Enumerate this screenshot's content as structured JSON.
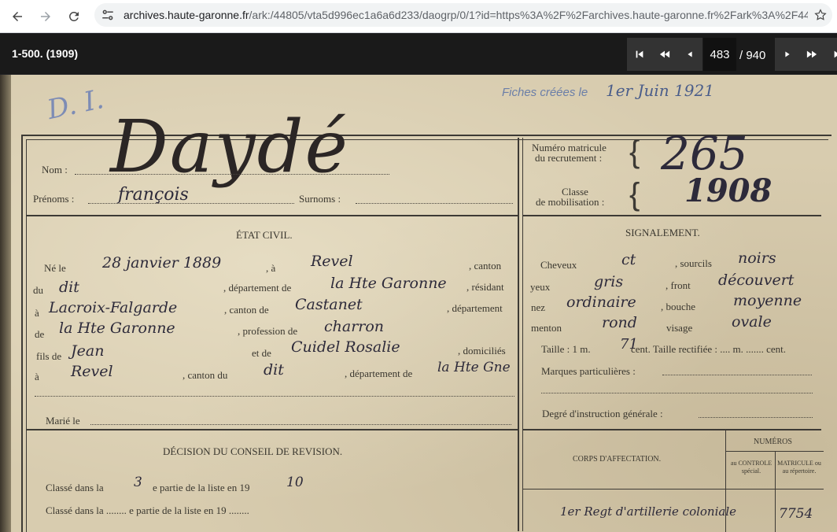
{
  "browser": {
    "url_host": "archives.haute-garonne.fr",
    "url_path": "/ark:/44805/vta5d996ec1a6a6d233/daogrp/0/1?id=https%3A%2F%2Farchives.haute-garonne.fr%2Fark%3A%2F44..."
  },
  "viewer": {
    "title": "1-500. (1909)",
    "current_page": "483",
    "total_pages": "/ 940"
  },
  "document": {
    "fiches_label": "Fiches créées le",
    "fiches_date": "1er Juin 1921",
    "stamp": "D. I.",
    "nom_label": "Nom :",
    "nom_value": "Daydé",
    "prenoms_label": "Prénoms :",
    "prenoms_value": "françois",
    "surnoms_label": "Surnoms :",
    "matricule_label_1": "Numéro matricule",
    "matricule_label_2": "du recrutement :",
    "matricule_value": "265",
    "classe_label_1": "Classe",
    "classe_label_2": "de mobilisation :",
    "classe_value": "1908",
    "etat_civil": "ÉTAT CIVIL.",
    "signalement": "SIGNALEMENT.",
    "ne_le_label": "Né le",
    "ne_le_value": "28 janvier 1889",
    "a_label": ", à",
    "a_value": "Revel",
    "canton_label": ", canton",
    "du_label": "du",
    "du_value": "dit",
    "departement_de_label": ", département de",
    "departement_value": "la Hte Garonne",
    "residant_label": ", résidant",
    "a2_label": "à",
    "residence_value": "Lacroix-Falgarde",
    "canton_de_label": ", canton de",
    "canton_de_value": "Castanet",
    "departement_label": ", département",
    "de_label": "de",
    "departement2_value": "la Hte Garonne",
    "profession_label": ", profession de",
    "profession_value": "charron",
    "fils_label": "fils de",
    "pere_value": "Jean",
    "et_label": "et de",
    "mere_value": "Cuidel Rosalie",
    "domicilies_label": ", domiciliés",
    "a3_label": "à",
    "domicile_value": "Revel",
    "canton_du_label": ", canton du",
    "canton_du_value": "dit",
    "departement_de2_label": ", département de",
    "departement3_value": "la Hte Gne",
    "marie_label": "Marié le",
    "cheveux_label": "Cheveux",
    "cheveux_value": "ct",
    "sourcils_label": ", sourcils",
    "sourcils_value": "noirs",
    "yeux_label": "yeux",
    "yeux_value": "gris",
    "front_label": ", front",
    "front_value": "découvert",
    "nez_label": "nez",
    "nez_value": "ordinaire",
    "bouche_label": ", bouche",
    "bouche_value": "moyenne",
    "menton_label": "menton",
    "menton_value": "rond",
    "visage_label": "visage",
    "visage_value": "ovale",
    "taille_label": "Taille : 1 m.",
    "taille_value": "71",
    "taille_cent": "cent. Taille rectifiée : .... m. ....... cent.",
    "marques_label": "Marques particulières :",
    "degre_label": "Degré d'instruction générale :",
    "decision_title": "DÉCISION DU CONSEIL DE REVISION.",
    "classe_dans_1a": "Classé dans la",
    "classe_dans_1_value": "3",
    "classe_dans_1b": "e partie de la liste en 19",
    "classe_dans_1_year": "10",
    "classe_dans_2": "Classé dans la ........ e partie de la liste en 19 ........",
    "numeros_label": "NUMÉROS",
    "corps_label": "CORPS D'AFFECTATION.",
    "au_controle": "au CONTROLE spécial.",
    "matricule_repertoire": "MATRICULE ou au répertoire.",
    "affectation_value": "1er Regt d'artillerie coloniale",
    "affectation_number": "7754"
  }
}
